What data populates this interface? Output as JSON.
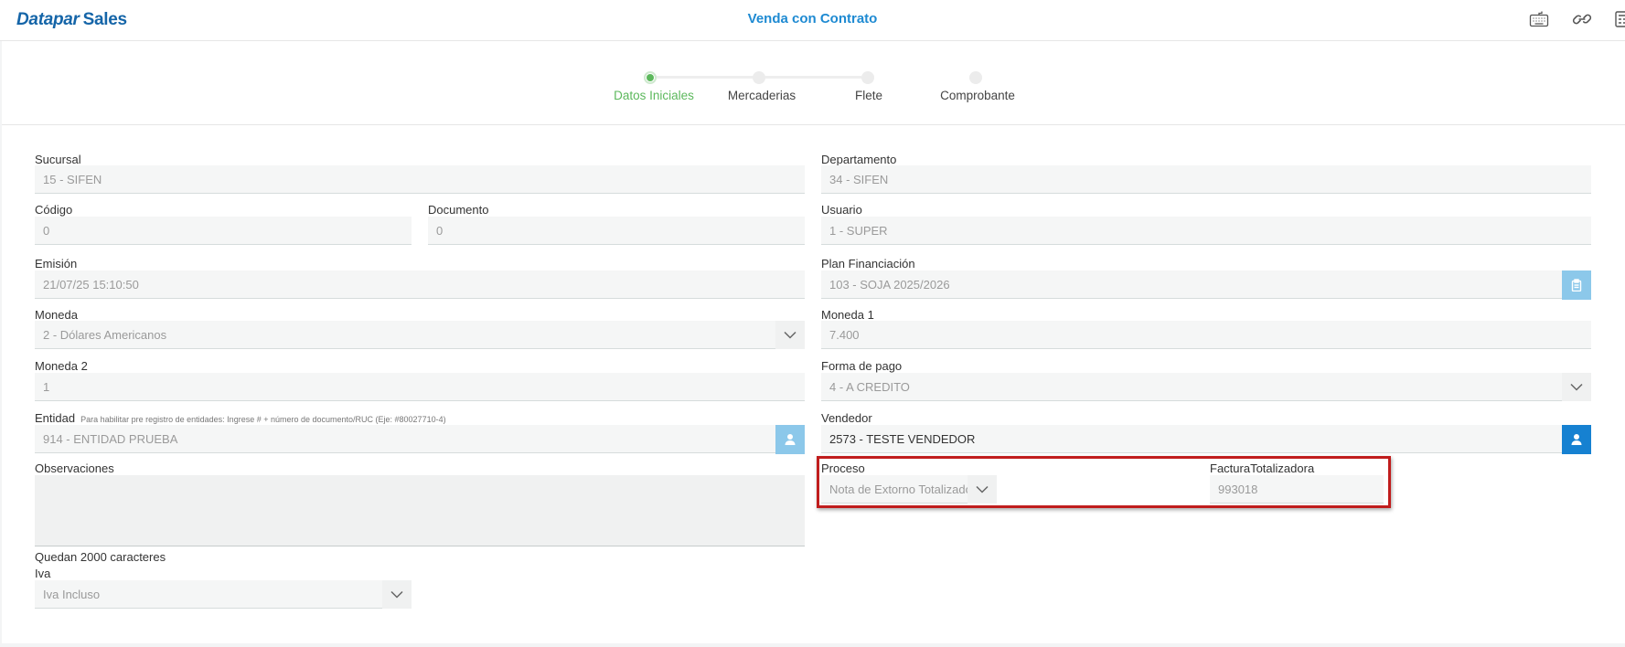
{
  "header": {
    "logo_brand": "Datapar",
    "logo_product": "Sales",
    "title": "Venda con Contrato",
    "icons": [
      "keyboard-icon",
      "link-icon",
      "calculator-icon"
    ]
  },
  "stepper": {
    "steps": [
      {
        "label": "Datos Iniciales",
        "active": true
      },
      {
        "label": "Mercaderias",
        "active": false
      },
      {
        "label": "Flete",
        "active": false
      },
      {
        "label": "Comprobante",
        "active": false
      }
    ]
  },
  "form": {
    "sucursal": {
      "label": "Sucursal",
      "value": "15 - SIFEN"
    },
    "departamento": {
      "label": "Departamento",
      "value": "34 - SIFEN"
    },
    "codigo": {
      "label": "Código",
      "value": "0"
    },
    "documento": {
      "label": "Documento",
      "value": "0"
    },
    "usuario": {
      "label": "Usuario",
      "value": "1 - SUPER"
    },
    "emision": {
      "label": "Emisión",
      "value": "21/07/25 15:10:50"
    },
    "plan_financiacion": {
      "label": "Plan Financiación",
      "value": "103 - SOJA 2025/2026"
    },
    "moneda": {
      "label": "Moneda",
      "value": "2 - Dólares Americanos"
    },
    "moneda1": {
      "label": "Moneda 1",
      "value": "7.400"
    },
    "moneda2": {
      "label": "Moneda 2",
      "value": "1"
    },
    "forma_pago": {
      "label": "Forma de pago",
      "value": "4 - A CREDITO"
    },
    "entidad": {
      "label": "Entidad",
      "hint": "Para habilitar pre registro de entidades: Ingrese # + número de documento/RUC (Eje: #80027710-4)",
      "value": "914 - ENTIDAD PRUEBA"
    },
    "vendedor": {
      "label": "Vendedor",
      "value": "2573 - TESTE VENDEDOR"
    },
    "observaciones": {
      "label": "Observaciones",
      "value": ""
    },
    "proceso": {
      "label": "Proceso",
      "value": "Nota de Extorno Totalizador"
    },
    "factura_totalizadora": {
      "label": "FacturaTotalizadora",
      "value": "993018"
    },
    "caracteres": "Quedan 2000 caracteres",
    "iva": {
      "label": "Iva",
      "value": "Iva Incluso"
    }
  },
  "colors": {
    "brand": "#1565a8",
    "title": "#1e8ad2",
    "step_active": "#5cb85c",
    "button_blue": "#1681d1",
    "button_light": "#8cc8ea",
    "highlight": "#c01d1d"
  }
}
